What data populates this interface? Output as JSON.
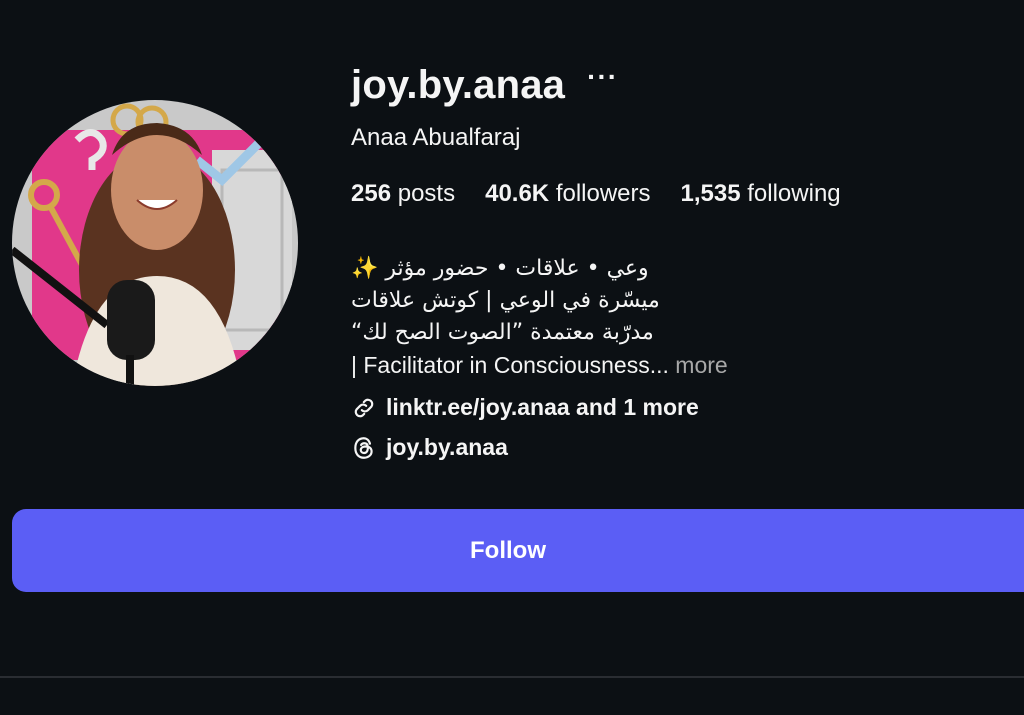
{
  "profile": {
    "username": "joy.by.anaa",
    "more_options_icon": "ellipsis-icon",
    "full_name": "Anaa Abualfaraj",
    "avatar": "profile-photo"
  },
  "stats": {
    "posts_count": "256",
    "posts_label": "posts",
    "followers_count": "40.6K",
    "followers_label": "followers",
    "following_count": "1,535",
    "following_label": "following"
  },
  "bio": {
    "line1": "وعي • علاقات • حضور مؤثر ✨",
    "line2": "ميسّرة في الوعي | كوتش علاقات",
    "line3": "مدرّبة معتمدة ”الصوت الصح لك“",
    "line4": "| Facilitator in Consciousness...",
    "more_label": "more"
  },
  "links": {
    "link_text": "linktr.ee/joy.anaa and 1 more",
    "link_icon": "link-icon",
    "threads_handle": "joy.by.anaa",
    "threads_icon": "threads-icon"
  },
  "actions": {
    "follow_label": "Follow"
  },
  "colors": {
    "background": "#0c1014",
    "follow_button": "#5b5ef5",
    "muted_text": "#a8a8a8"
  }
}
